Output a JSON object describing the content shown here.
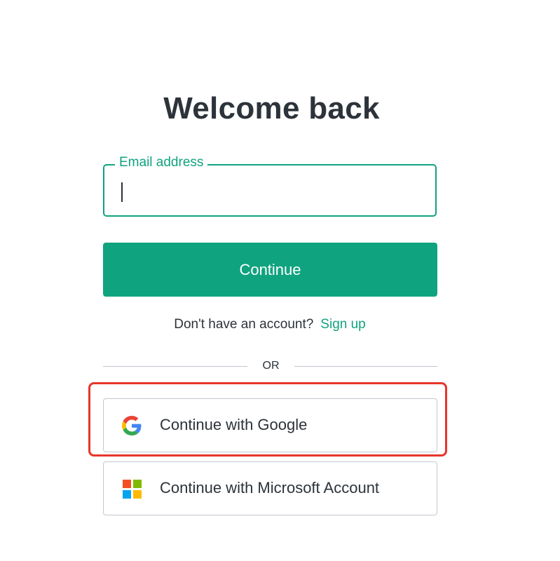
{
  "header": {
    "title": "Welcome back"
  },
  "login_form": {
    "email_label": "Email address",
    "email_value": "",
    "continue_label": "Continue"
  },
  "signup": {
    "prompt": "Don't have an account?",
    "link_label": "Sign up"
  },
  "divider": {
    "label": "OR"
  },
  "social_login": {
    "google_label": "Continue with Google",
    "google_icon": "google-icon",
    "microsoft_label": "Continue with Microsoft Account",
    "microsoft_icon": "microsoft-icon"
  },
  "colors": {
    "accent": "#10a37f",
    "text": "#2d333a",
    "border": "#c2c8d0",
    "highlight": "#e8352a",
    "microsoft_red": "#f25022",
    "microsoft_green": "#7fba00",
    "microsoft_blue": "#00a4ef",
    "microsoft_yellow": "#ffb900"
  }
}
